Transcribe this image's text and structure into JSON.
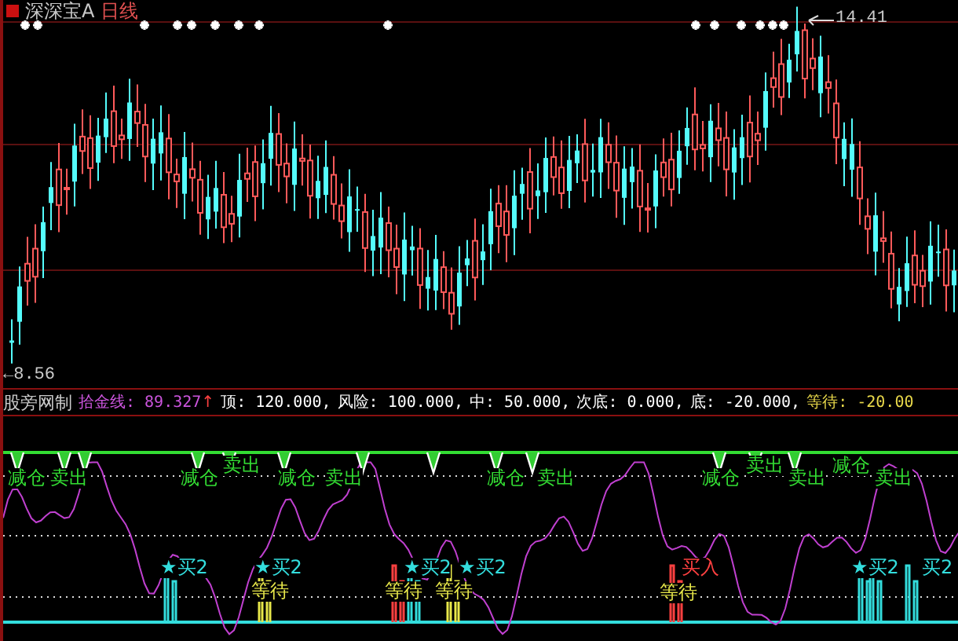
{
  "title": {
    "name": "深深宝A",
    "period": "日线"
  },
  "price_chart": {
    "high_label": "14.41",
    "low_label": "←8.56"
  },
  "indicator": {
    "name": "股旁网制",
    "fields": [
      {
        "text": "拾金线: 89.327",
        "arrow": "↑",
        "color": "#cc55dd"
      },
      {
        "text": "顶: 120.000,",
        "color": "#ffffff"
      },
      {
        "text": "风险: 100.000,",
        "color": "#ffffff"
      },
      {
        "text": "中: 50.000,",
        "color": "#ffffff"
      },
      {
        "text": "次底: 0.000,",
        "color": "#ffffff"
      },
      {
        "text": "底: -20.000,",
        "color": "#ffffff"
      },
      {
        "text": "等待: -20.00",
        "color": "#e8d84a"
      }
    ]
  },
  "signals": [
    {
      "kind": "sell",
      "text": "减仓"
    },
    {
      "kind": "sell",
      "text": "卖出"
    },
    {
      "kind": "sell",
      "text": "减仓"
    },
    {
      "kind": "sell",
      "text": "卖出"
    },
    {
      "kind": "sell",
      "text": "减仓"
    },
    {
      "kind": "sell",
      "text": "卖出"
    },
    {
      "kind": "sell",
      "text": "减仓"
    },
    {
      "kind": "sell",
      "text": "卖出"
    },
    {
      "kind": "sell",
      "text": "减仓"
    },
    {
      "kind": "sell",
      "text": "卖出"
    },
    {
      "kind": "sell",
      "text": "卖出"
    },
    {
      "kind": "sell",
      "text": "减仓"
    },
    {
      "kind": "sell",
      "text": "卖出"
    },
    {
      "kind": "buy",
      "text": "★买2"
    },
    {
      "kind": "buy",
      "text": "★买2"
    },
    {
      "kind": "wait",
      "text": "等待"
    },
    {
      "kind": "buy",
      "text": "★买2"
    },
    {
      "kind": "wait",
      "text": "等待"
    },
    {
      "kind": "buy",
      "text": "★买2"
    },
    {
      "kind": "wait",
      "text": "等待"
    },
    {
      "kind": "strong",
      "text": "买入"
    },
    {
      "kind": "wait",
      "text": "等待"
    },
    {
      "kind": "buy",
      "text": "★买2"
    },
    {
      "kind": "buy",
      "text": "买2"
    }
  ]
}
